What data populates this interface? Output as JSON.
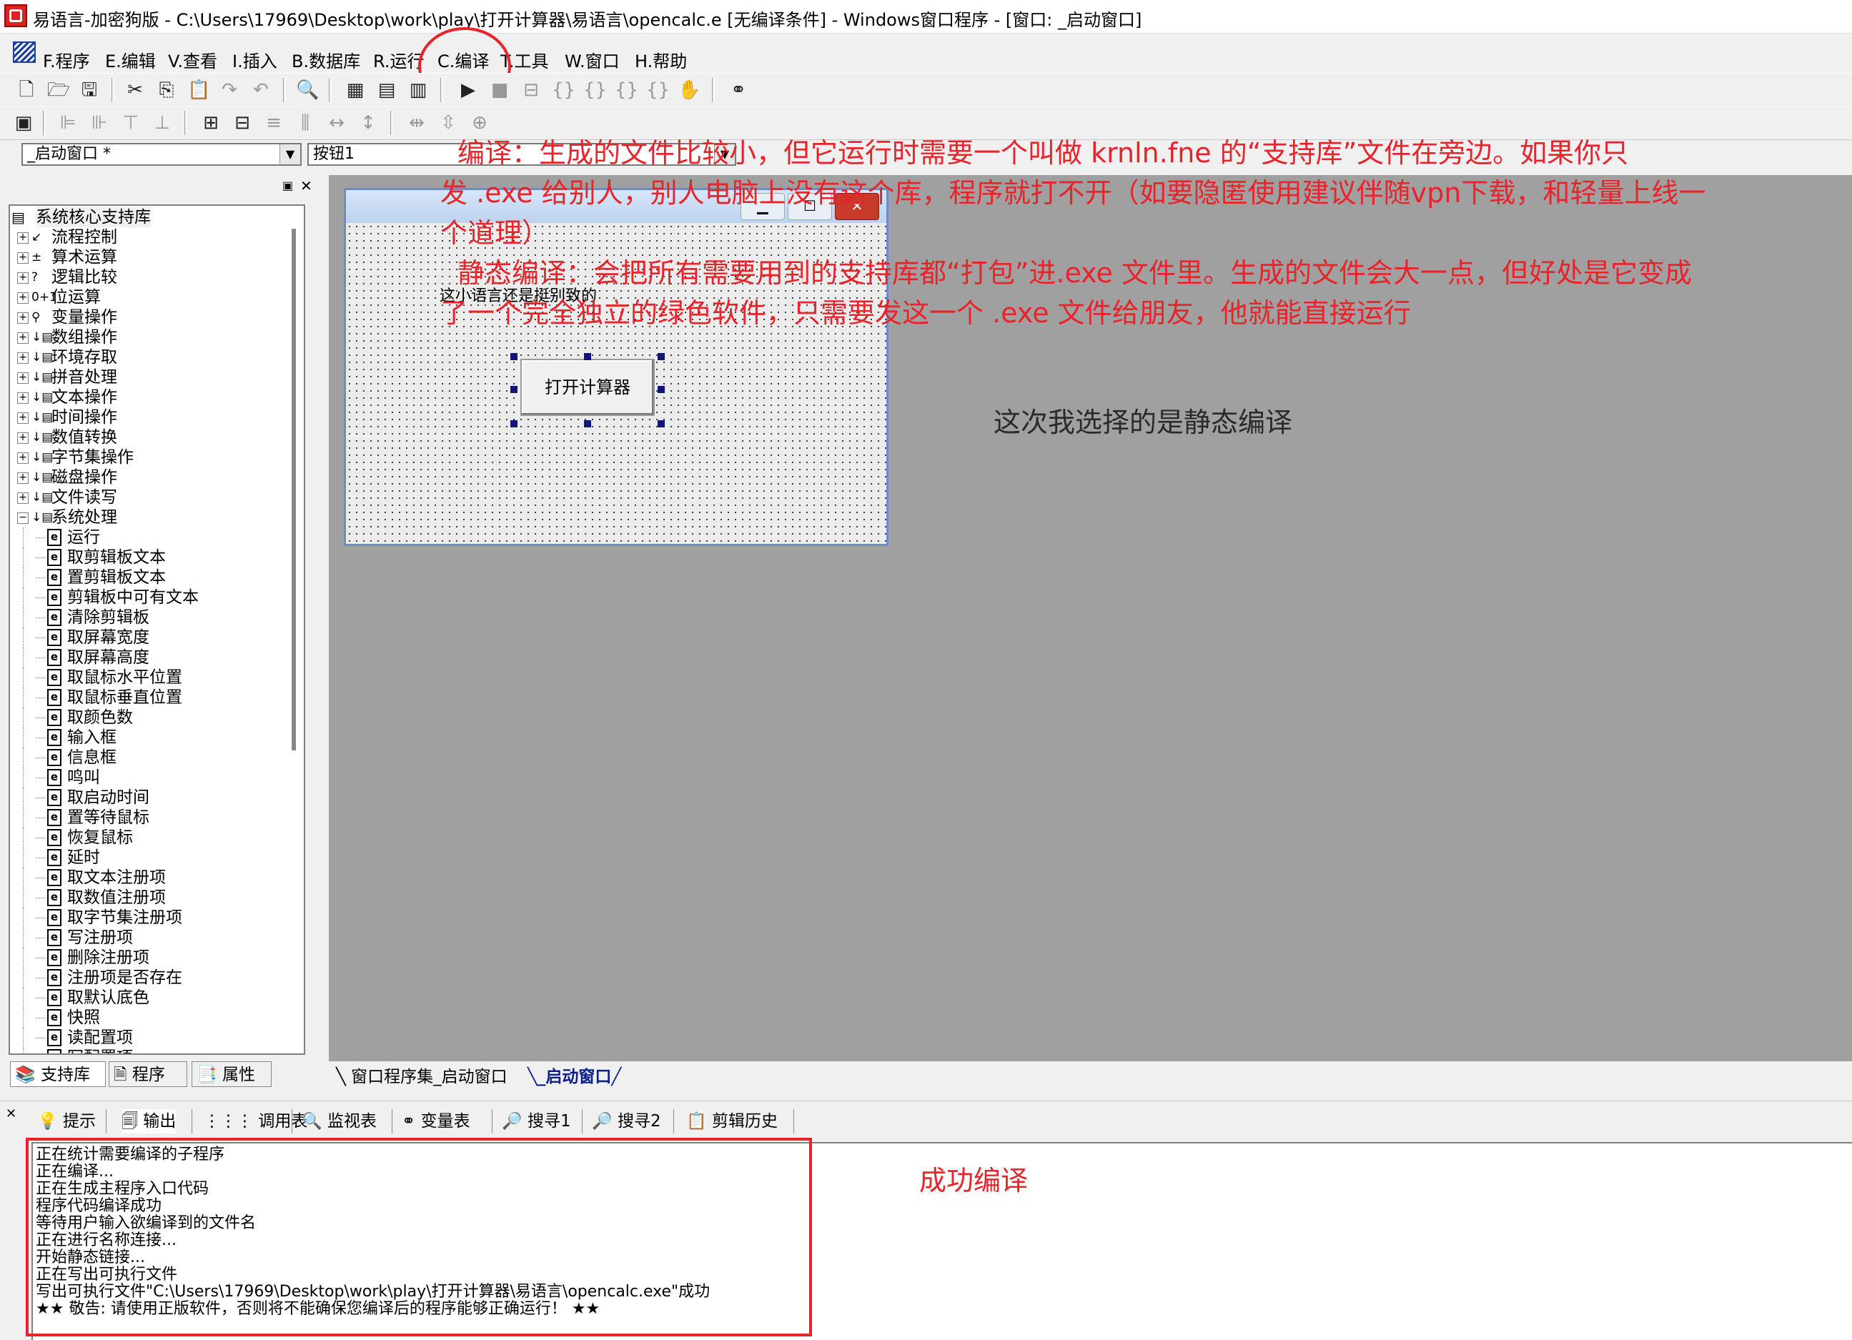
{
  "window": {
    "title": "易语言-加密狗版 - C:\\Users\\17969\\Desktop\\work\\play\\打开计算器\\易语言\\opencalc.e [无编译条件] - Windows窗口程序 - [窗口: _启动窗口]"
  },
  "menu": [
    "F.程序",
    "E.编辑",
    "V.查看",
    "I.插入",
    "B.数据库",
    "R.运行",
    "C.编译",
    "T.工具",
    "W.窗口",
    "H.帮助"
  ],
  "combos": {
    "window_select": "_启动窗口  *",
    "component_select": "按钮1"
  },
  "tree": {
    "root": "系统核心支持库",
    "categories": [
      "流程控制",
      "算术运算",
      "逻辑比较",
      "位运算",
      "变量操作",
      "数组操作",
      "环境存取",
      "拼音处理",
      "文本操作",
      "时间操作",
      "数值转换",
      "字节集操作",
      "磁盘操作",
      "文件读写",
      "系统处理"
    ],
    "items": [
      "运行",
      "取剪辑板文本",
      "置剪辑板文本",
      "剪辑板中可有文本",
      "清除剪辑板",
      "取屏幕宽度",
      "取屏幕高度",
      "取鼠标水平位置",
      "取鼠标垂直位置",
      "取颜色数",
      "输入框",
      "信息框",
      "鸣叫",
      "取启动时间",
      "置等待鼠标",
      "恢复鼠标",
      "延时",
      "取文本注册项",
      "取数值注册项",
      "取字节集注册项",
      "写注册项",
      "删除注册项",
      "注册项是否存在",
      "取默认底色",
      "快照",
      "读配置项",
      "写配置项"
    ]
  },
  "left_tabs": [
    "支持库",
    "程序",
    "属性"
  ],
  "form": {
    "label_text": "这小语言还是挺别致的",
    "button_text": "打开计算器"
  },
  "doc_tabs": [
    "窗口程序集_启动窗口",
    "_启动窗口"
  ],
  "output_tabs": [
    "提示",
    "输出",
    "调用表",
    "监视表",
    "变量表",
    "搜寻1",
    "搜寻2",
    "剪辑历史"
  ],
  "output_lines": [
    "正在统计需要编译的子程序",
    "正在编译...",
    "正在生成主程序入口代码",
    "程序代码编译成功",
    "等待用户输入欲编译到的文件名",
    "正在进行名称连接...",
    "开始静态链接...",
    "正在写出可执行文件",
    "写出可执行文件\"C:\\Users\\17969\\Desktop\\work\\play\\打开计算器\\易语言\\opencalc.exe\"成功",
    "★★ 敬告: 请使用正版软件，否则将不能确保您编译后的程序能够正确运行！ ★★"
  ],
  "annotations": {
    "compile_line1": "编译：生成的文件比较小，但它运行时需要一个叫做 krnln.fne 的“支持库”文件在旁边。如果你只",
    "compile_line2": "发 .exe 给别人，别人电脑上没有这个库，程序就打不开（如要隐匿使用建议伴随vpn下载，和轻量上线一",
    "compile_line3": "个道理）",
    "static_line1": "静态编译：会把所有需要用到的支持库都“打包”进.exe 文件里。生成的文件会大一点，但好处是它变成",
    "static_line2": "了一个完全独立的绿色软件，只需要发这一个 .exe 文件给朋友，他就能直接运行",
    "choice": "这次我选择的是静态编译",
    "success": "成功编译"
  },
  "colors": {
    "annotation": "#e8232a",
    "tree_handle": "#111577",
    "design_bg": "#a0a0a0"
  }
}
